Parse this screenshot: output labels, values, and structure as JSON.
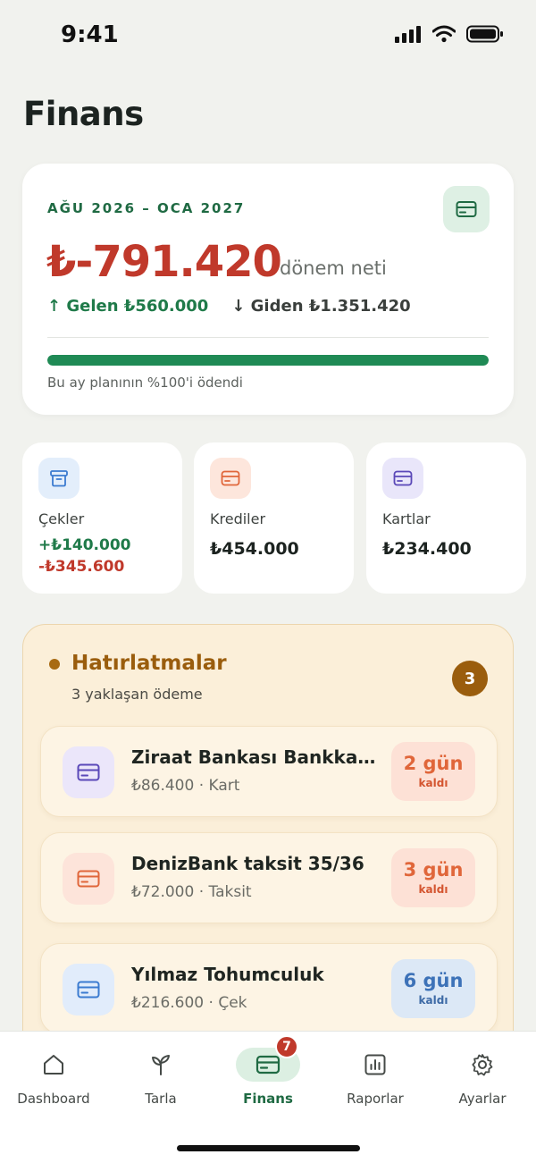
{
  "status_bar": {
    "time": "9:41"
  },
  "page_title": "Finans",
  "summary": {
    "period": "AĞU 2026 – OCA 2027",
    "net_amount": "₺-791.420",
    "net_label": "dönem neti",
    "income": "↑ Gelen ₺560.000",
    "expense": "↓ Giden ₺1.351.420",
    "progress_percent": 100,
    "progress_caption": "Bu ay planının %100'i ödendi"
  },
  "mini_cards": {
    "cekler": {
      "label": "Çekler",
      "positive": "+₺140.000",
      "negative": "-₺345.600"
    },
    "krediler": {
      "label": "Krediler",
      "value": "₺454.000"
    },
    "kartlar": {
      "label": "Kartlar",
      "value": "₺234.400"
    }
  },
  "reminders": {
    "title": "Hatırlatmalar",
    "subtitle": "3 yaklaşan ödeme",
    "count": "3",
    "items": [
      {
        "title": "Ziraat Bankası Bankkart B...",
        "subtitle": "₺86.400 · Kart",
        "days": "2 gün",
        "note": "kaldı"
      },
      {
        "title": "DenizBank taksit 35/36",
        "subtitle": "₺72.000 · Taksit",
        "days": "3 gün",
        "note": "kaldı"
      },
      {
        "title": "Yılmaz Tohumculuk",
        "subtitle": "₺216.600 · Çek",
        "days": "6 gün",
        "note": "kaldı"
      }
    ]
  },
  "tabs": [
    {
      "label": "Dashboard",
      "icon": "home-icon"
    },
    {
      "label": "Tarla",
      "icon": "sprout-icon"
    },
    {
      "label": "Finans",
      "icon": "card-icon",
      "badge": "7",
      "active": true
    },
    {
      "label": "Raporlar",
      "icon": "chart-icon"
    },
    {
      "label": "Ayarlar",
      "icon": "gear-icon"
    }
  ],
  "colors": {
    "accent_green": "#1f6a43",
    "negative_red": "#c0392b",
    "reminder_brown": "#9a5d0d",
    "background": "#f1f2ee"
  }
}
